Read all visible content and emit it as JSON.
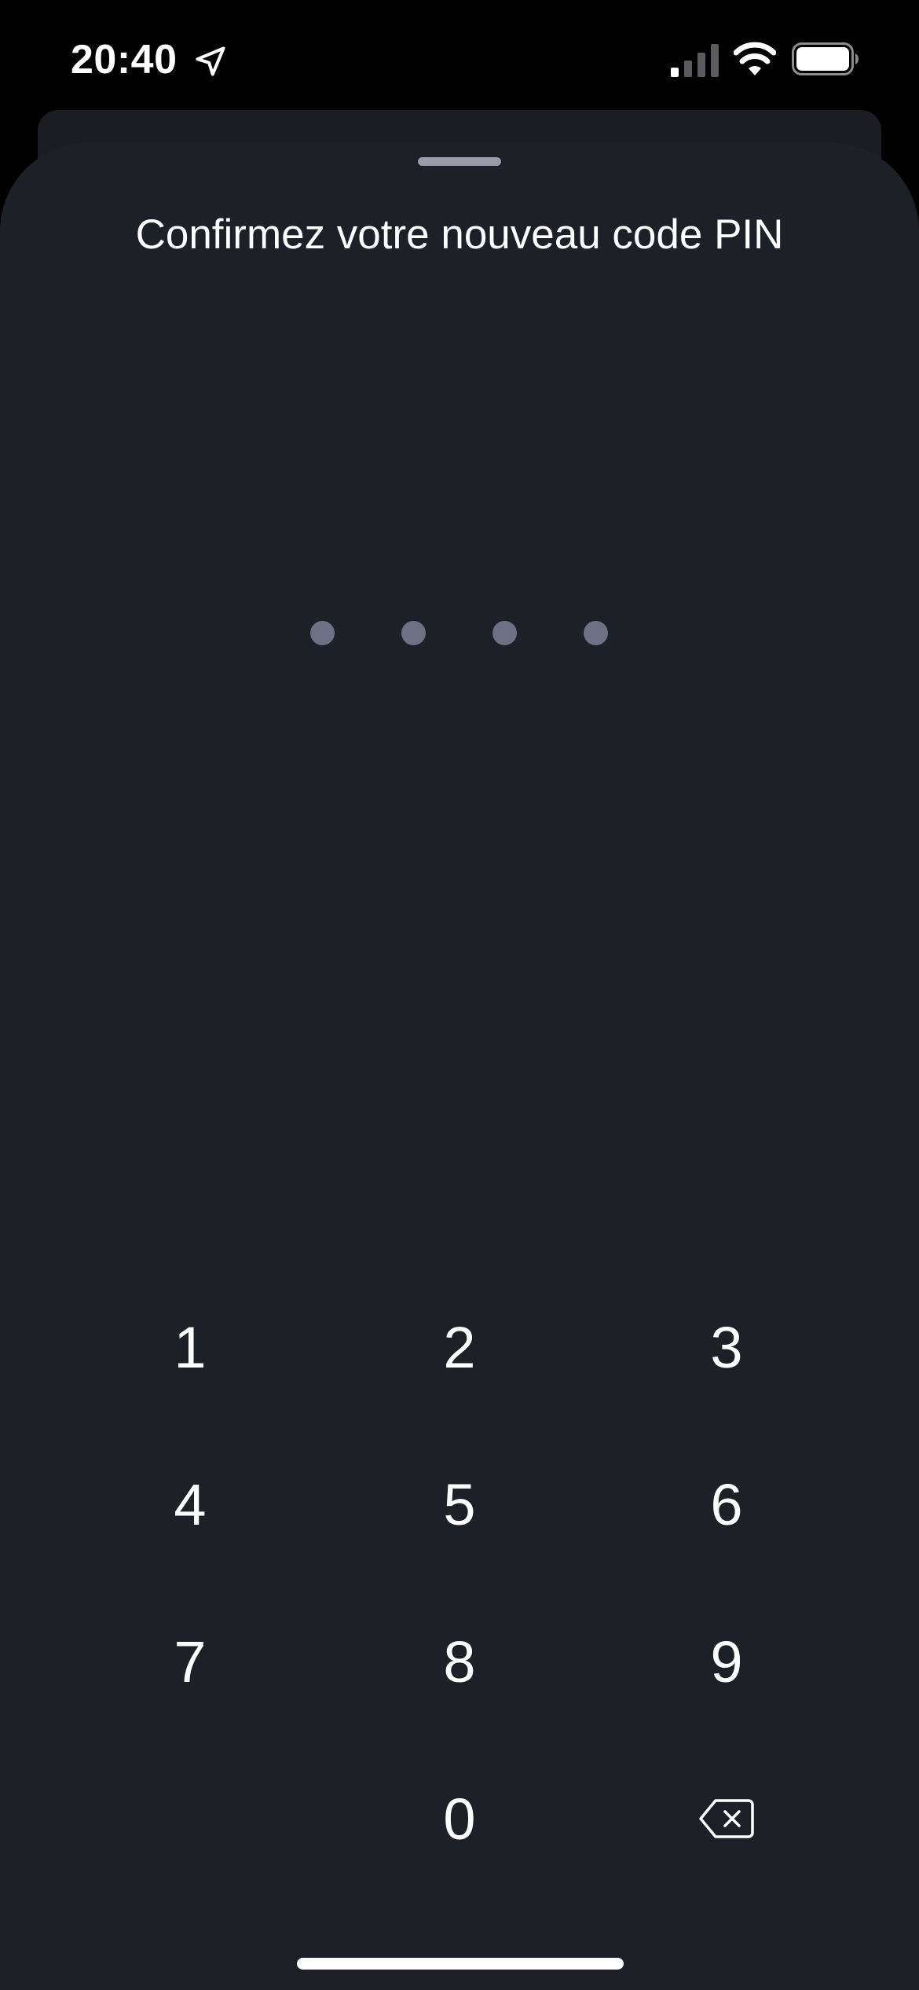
{
  "status_bar": {
    "time": "20:40",
    "icons": {
      "location": "location-arrow-icon",
      "signal": "cellular-signal-icon",
      "wifi": "wifi-icon",
      "battery": "battery-icon"
    },
    "signal_bars_active": 1,
    "battery_level": 1.0
  },
  "sheet": {
    "title": "Confirmez votre nouveau code PIN",
    "pin_length": 4,
    "pin_filled": 0
  },
  "keypad": {
    "keys": [
      "1",
      "2",
      "3",
      "4",
      "5",
      "6",
      "7",
      "8",
      "9",
      "0"
    ],
    "backspace_icon": "backspace-icon"
  },
  "colors": {
    "background": "#000000",
    "sheet": "#1e2028",
    "card_back": "#1c1d22",
    "pin_dot": "#6e7084",
    "grabber": "#9a9ba8",
    "text": "#ffffff"
  }
}
